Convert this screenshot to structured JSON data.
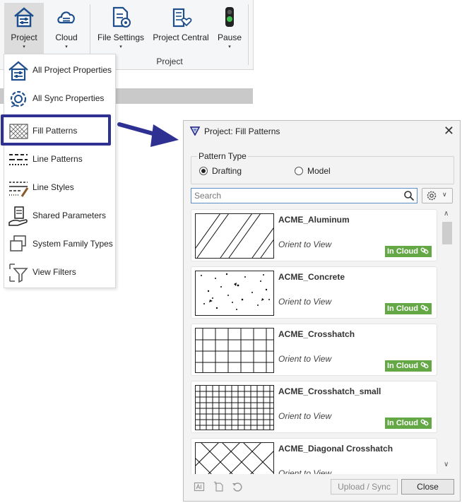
{
  "ribbon": {
    "buttons": [
      {
        "label": "Project",
        "icon": "house-sliders-icon",
        "has_dropdown": true
      },
      {
        "label": "Cloud",
        "icon": "cloud-sliders-icon",
        "has_dropdown": true
      },
      {
        "label": "File Settings",
        "icon": "document-gear-icon",
        "has_dropdown": true
      },
      {
        "label": "Project Central",
        "icon": "building-heart-icon",
        "has_dropdown": false
      },
      {
        "label": "Pause",
        "icon": "traffic-light-icon",
        "has_dropdown": true
      }
    ],
    "group_label": "Project",
    "dropdown_glyph": "▾"
  },
  "menu": {
    "items": [
      {
        "label": "All Project Properties",
        "icon": "house-sliders-icon"
      },
      {
        "label": "All Sync Properties",
        "icon": "gear-sync-icon"
      },
      {
        "label": "Fill Patterns",
        "icon": "hatch-pattern-icon"
      },
      {
        "label": "Line Patterns",
        "icon": "dashed-lines-icon"
      },
      {
        "label": "Line Styles",
        "icon": "line-styles-icon"
      },
      {
        "label": "Shared Parameters",
        "icon": "hand-document-icon"
      },
      {
        "label": "System Family Types",
        "icon": "stacked-squares-icon"
      },
      {
        "label": "View Filters",
        "icon": "funnel-view-icon"
      }
    ],
    "highlighted_item": "Fill Patterns",
    "highlight_color": "#2e3192"
  },
  "dialog": {
    "title": "Project: Fill Patterns",
    "close_glyph": "✕",
    "pattern_type": {
      "legend": "Pattern Type",
      "options": [
        "Drafting",
        "Model"
      ],
      "selected": "Drafting"
    },
    "search": {
      "placeholder": "Search",
      "value": ""
    },
    "patterns": [
      {
        "name": "ACME_Aluminum",
        "orient": "Orient to View",
        "status": "In Cloud",
        "pattern": "diagonal"
      },
      {
        "name": "ACME_Concrete",
        "orient": "Orient to View",
        "status": "In Cloud",
        "pattern": "concrete"
      },
      {
        "name": "ACME_Crosshatch",
        "orient": "Orient to View",
        "status": "In Cloud",
        "pattern": "grid"
      },
      {
        "name": "ACME_Crosshatch_small",
        "orient": "Orient to View",
        "status": "In Cloud",
        "pattern": "grid-small"
      },
      {
        "name": "ACME_Diagonal Crosshatch",
        "orient": "Orient to View",
        "status": "",
        "pattern": "diagonal-cross"
      }
    ],
    "buttons": {
      "upload": "Upload / Sync",
      "close": "Close"
    },
    "colors": {
      "in_cloud": "#63a844",
      "search_border": "#5b8fc7"
    }
  }
}
